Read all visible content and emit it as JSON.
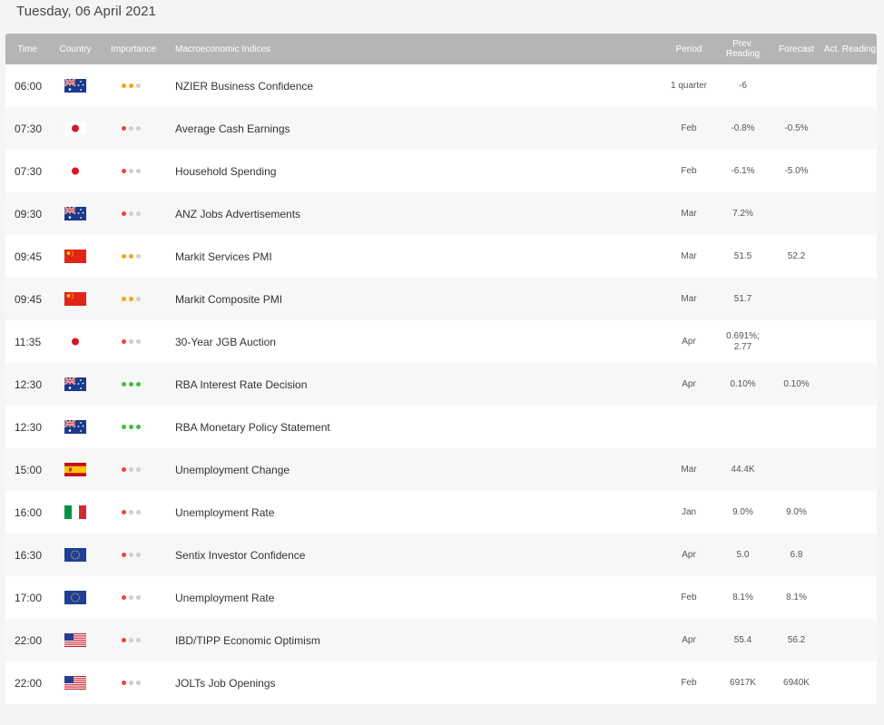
{
  "page": {
    "date_title": "Tuesday, 06 April 2021"
  },
  "table": {
    "headers": {
      "time": "Time",
      "country": "Country",
      "importance": "Importance",
      "indices": "Macroeconomic Indices",
      "period": "Period",
      "prev": "Prev. Reading",
      "forecast": "Forecast",
      "actual": "Act. Reading"
    },
    "colors": {
      "low": "#e8453c",
      "medium": "#f3a712",
      "high": "#3fbf3a",
      "inactive": "#cfcfcf",
      "header_bg": "#b5b5b5"
    },
    "rows": [
      {
        "time": "06:00",
        "flag": "australia-flag",
        "importance": "medium",
        "name": "NZIER Business Confidence",
        "period": "1 quarter",
        "prev": "-6",
        "forecast": "",
        "actual": ""
      },
      {
        "time": "07:30",
        "flag": "japan-flag",
        "importance": "low",
        "name": "Average Cash Earnings",
        "period": "Feb",
        "prev": "-0.8%",
        "forecast": "-0.5%",
        "actual": ""
      },
      {
        "time": "07:30",
        "flag": "japan-flag",
        "importance": "low",
        "name": "Household Spending",
        "period": "Feb",
        "prev": "-6.1%",
        "forecast": "-5.0%",
        "actual": ""
      },
      {
        "time": "09:30",
        "flag": "australia-flag",
        "importance": "low",
        "name": "ANZ Jobs Advertisements",
        "period": "Mar",
        "prev": "7.2%",
        "forecast": "",
        "actual": ""
      },
      {
        "time": "09:45",
        "flag": "china-flag",
        "importance": "medium",
        "name": "Markit Services PMI",
        "period": "Mar",
        "prev": "51.5",
        "forecast": "52.2",
        "actual": ""
      },
      {
        "time": "09:45",
        "flag": "china-flag",
        "importance": "medium",
        "name": "Markit Composite PMI",
        "period": "Mar",
        "prev": "51.7",
        "forecast": "",
        "actual": ""
      },
      {
        "time": "11:35",
        "flag": "japan-flag",
        "importance": "low",
        "name": "30-Year JGB Auction",
        "period": "Apr",
        "prev": "0.691%; 2.77",
        "forecast": "",
        "actual": ""
      },
      {
        "time": "12:30",
        "flag": "australia-flag",
        "importance": "high",
        "name": "RBA Interest Rate Decision",
        "period": "Apr",
        "prev": "0.10%",
        "forecast": "0.10%",
        "actual": ""
      },
      {
        "time": "12:30",
        "flag": "australia-flag",
        "importance": "high",
        "name": "RBA Monetary Policy Statement",
        "period": "",
        "prev": "",
        "forecast": "",
        "actual": ""
      },
      {
        "time": "15:00",
        "flag": "spain-flag",
        "importance": "low",
        "name": "Unemployment Change",
        "period": "Mar",
        "prev": "44.4K",
        "forecast": "",
        "actual": ""
      },
      {
        "time": "16:00",
        "flag": "italy-flag",
        "importance": "low",
        "name": "Unemployment Rate",
        "period": "Jan",
        "prev": "9.0%",
        "forecast": "9.0%",
        "actual": ""
      },
      {
        "time": "16:30",
        "flag": "eu-flag",
        "importance": "low",
        "name": "Sentix Investor Confidence",
        "period": "Apr",
        "prev": "5.0",
        "forecast": "6.8",
        "actual": ""
      },
      {
        "time": "17:00",
        "flag": "eu-flag",
        "importance": "low",
        "name": "Unemployment Rate",
        "period": "Feb",
        "prev": "8.1%",
        "forecast": "8.1%",
        "actual": ""
      },
      {
        "time": "22:00",
        "flag": "usa-flag",
        "importance": "low",
        "name": "IBD/TIPP Economic Optimism",
        "period": "Apr",
        "prev": "55.4",
        "forecast": "56.2",
        "actual": ""
      },
      {
        "time": "22:00",
        "flag": "usa-flag",
        "importance": "low",
        "name": "JOLTs Job Openings",
        "period": "Feb",
        "prev": "6917K",
        "forecast": "6940K",
        "actual": ""
      }
    ]
  }
}
